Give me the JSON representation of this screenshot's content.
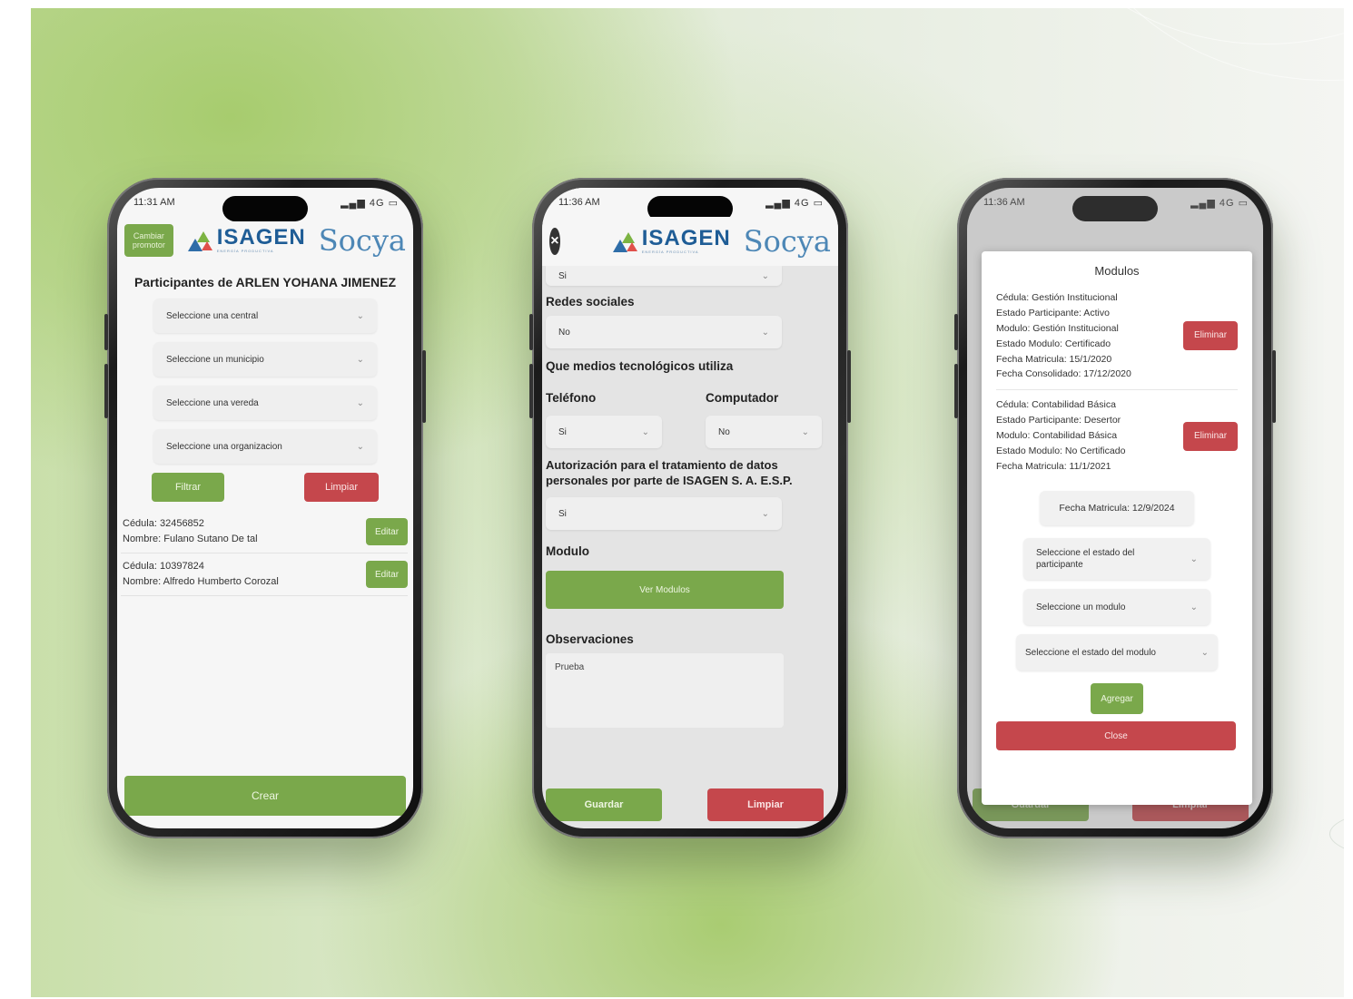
{
  "brand": {
    "isagen": "ISAGEN",
    "isagen_sub": "ENERGÍA PRODUCTIVA",
    "socya": "Socya"
  },
  "phone1": {
    "time": "11:31 AM",
    "signal": "4G",
    "promoter_button": "Cambiar promotor",
    "title": "Participantes de ARLEN YOHANA JIMENEZ",
    "selects": [
      "Seleccione una central",
      "Seleccione un municipio",
      "Seleccione una vereda",
      "Seleccione una organizacion"
    ],
    "filter_button": "Filtrar",
    "clear_button": "Limpiar",
    "participants": [
      {
        "cedula": "Cédula: 32456852",
        "nombre": "Nombre: Fulano Sutano De tal",
        "edit": "Editar"
      },
      {
        "cedula": "Cédula: 10397824",
        "nombre": "Nombre: Alfredo  Humberto  Corozal",
        "edit": "Editar"
      }
    ],
    "create_button": "Crear"
  },
  "phone2": {
    "time": "11:36 AM",
    "signal": "4G",
    "top_select": "Si",
    "redes_label": "Redes sociales",
    "redes_value": "No",
    "medios_label": "Que medios tecnológicos utiliza",
    "telefono_label": "Teléfono",
    "telefono_value": "Si",
    "computador_label": "Computador",
    "computador_value": "No",
    "autorizacion_label": "Autorización para el tratamiento de datos personales por parte de ISAGEN S. A. E.S.P.",
    "autorizacion_value": "Si",
    "modulo_label": "Modulo",
    "ver_modulos_button": "Ver Modulos",
    "observaciones_label": "Observaciones",
    "observaciones_value": "Prueba",
    "save_button": "Guardar",
    "clear_button": "Limpiar"
  },
  "phone3": {
    "time": "11:36 AM",
    "signal": "4G",
    "modal_title": "Modulos",
    "entries": [
      {
        "lines": [
          "Cédula: Gestión Institucional",
          "Estado Participante: Activo",
          "Modulo: Gestión Institucional",
          "Estado Modulo: Certificado",
          "Fecha Matricula: 15/1/2020",
          "Fecha Consolidado: 17/12/2020"
        ],
        "delete": "Eliminar"
      },
      {
        "lines": [
          "Cédula: Contabilidad Básica",
          "Estado Participante: Desertor",
          "Modulo: Contabilidad Básica",
          "Estado Modulo: No Certificado",
          "Fecha Matricula: 11/1/2021"
        ],
        "delete": "Eliminar"
      }
    ],
    "fecha_matricula": "Fecha Matricula: 12/9/2024",
    "select_estado_participante": "Seleccione el estado del participante",
    "select_modulo": "Seleccione un modulo",
    "select_estado_modulo": "Seleccione el estado del modulo",
    "add_button": "Agregar",
    "close_button": "Close",
    "bg_save": "Guardar",
    "bg_clear": "Limpiar"
  }
}
